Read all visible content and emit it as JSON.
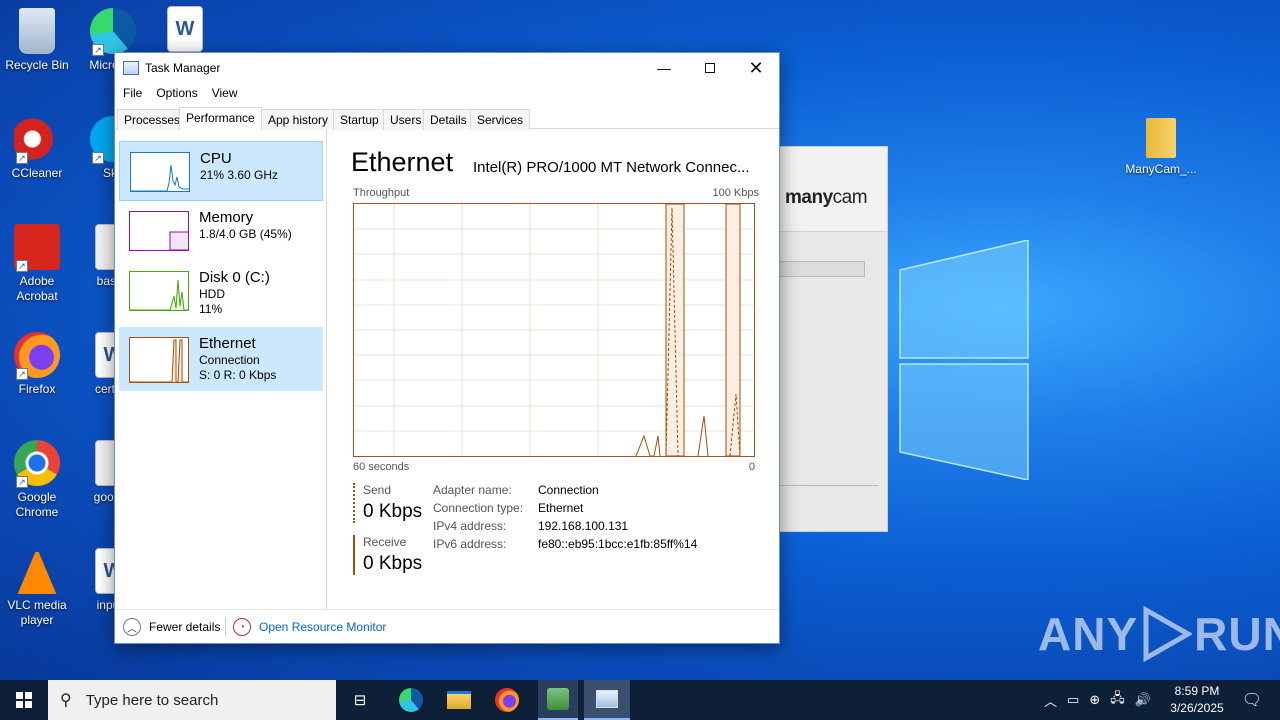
{
  "desktop": {
    "icons": [
      {
        "label": "Recycle Bin",
        "icon": "recycle-bin-icon"
      },
      {
        "label": "CCleaner",
        "icon": "ccleaner-icon"
      },
      {
        "label": "Adobe Acrobat",
        "icon": "adobe-acrobat-icon"
      },
      {
        "label": "Firefox",
        "icon": "firefox-icon"
      },
      {
        "label": "Google Chrome",
        "icon": "chrome-icon"
      },
      {
        "label": "VLC media player",
        "icon": "vlc-icon"
      },
      {
        "label": "Micro Ed",
        "icon": "edge-icon"
      },
      {
        "label": "Sky",
        "icon": "skype-icon"
      },
      {
        "label": "basea",
        "icon": "image-file-icon"
      },
      {
        "label": "certain",
        "icon": "word-doc-icon"
      },
      {
        "label": "goodsv",
        "icon": "image-file-icon"
      },
      {
        "label": "inputu",
        "icon": "word-doc-icon"
      },
      {
        "label": "",
        "icon": "word-doc-icon"
      },
      {
        "label": "ManyCam_...",
        "icon": "folder-icon"
      }
    ]
  },
  "manycam": {
    "logo_bold": "many",
    "logo_rest": "cam"
  },
  "task_manager": {
    "title": "Task Manager",
    "menu": [
      "File",
      "Options",
      "View"
    ],
    "tabs": [
      "Processes",
      "Performance",
      "App history",
      "Startup",
      "Users",
      "Details",
      "Services"
    ],
    "active_tab": "Performance",
    "sidebar": [
      {
        "name": "CPU",
        "line1": "21%  3.60 GHz",
        "line2": "",
        "color": "#117dbb"
      },
      {
        "name": "Memory",
        "line1": "1.8/4.0 GB (45%)",
        "line2": "",
        "color": "#8b12ae"
      },
      {
        "name": "Disk 0 (C:)",
        "line1": "HDD",
        "line2": "11%",
        "color": "#4da60c"
      },
      {
        "name": "Ethernet",
        "line1": "Connection",
        "line2": "S: 0 R: 0 Kbps",
        "color": "#a74f01"
      }
    ],
    "panel": {
      "title": "Ethernet",
      "adapter": "Intel(R) PRO/1000 MT Network Connec...",
      "throughput_label": "Throughput",
      "max_label": "100 Kbps",
      "time_label": "60 seconds",
      "zero_label": "0",
      "send_label": "Send",
      "send_value": "0 Kbps",
      "receive_label": "Receive",
      "receive_value": "0 Kbps",
      "properties": [
        {
          "key": "Adapter name:",
          "value": "Connection"
        },
        {
          "key": "Connection type:",
          "value": "Ethernet"
        },
        {
          "key": "IPv4 address:",
          "value": "192.168.100.131"
        },
        {
          "key": "IPv6 address:",
          "value": "fe80::eb95:1bcc:e1fb:85ff%14"
        }
      ]
    },
    "footer": {
      "fewer_details": "Fewer details",
      "resource_monitor": "Open Resource Monitor"
    }
  },
  "watermark": {
    "left": "ANY",
    "right": "RUN"
  },
  "taskbar": {
    "search_placeholder": "Type here to search",
    "time": "8:59 PM",
    "date": "3/26/2025"
  },
  "colors": {
    "accent": "#0078d7",
    "ethernet": "#a74f01"
  }
}
